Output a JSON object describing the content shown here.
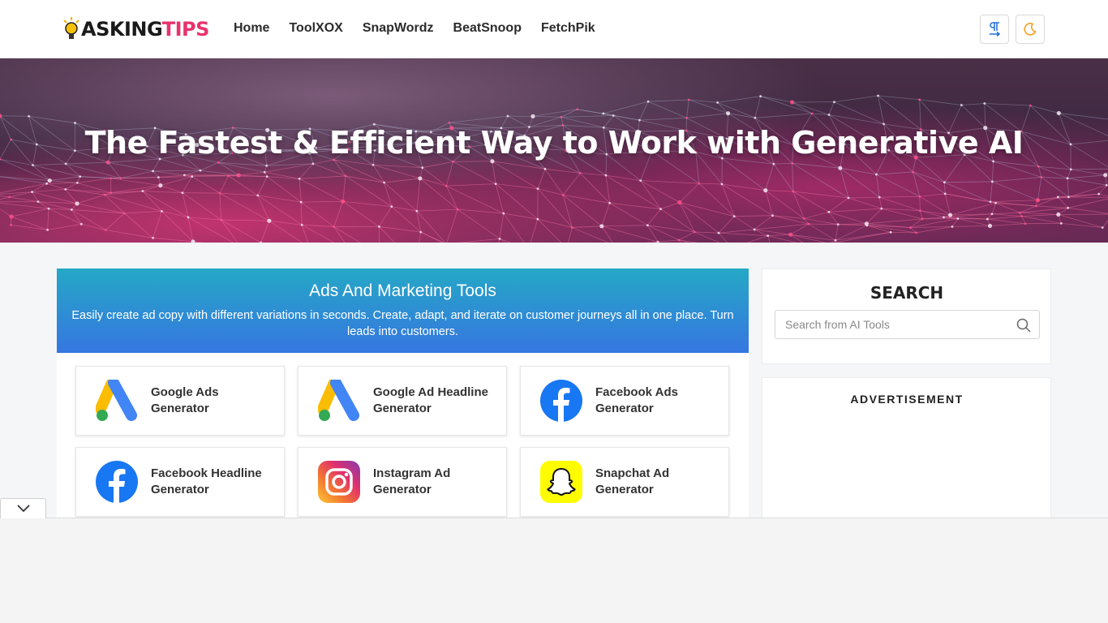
{
  "header": {
    "logo": {
      "part1": "ASKING",
      "part2": "TIPS"
    },
    "nav": [
      "Home",
      "ToolXOX",
      "SnapWordz",
      "BeatSnoop",
      "FetchPik"
    ]
  },
  "hero": {
    "title": "The Fastest & Efficient Way to Work with Generative AI"
  },
  "main": {
    "section_title": "Ads And Marketing Tools",
    "section_desc": "Easily create ad copy with different variations in seconds. Create, adapt, and iterate on customer journeys all in one place. Turn leads into customers.",
    "tools": [
      {
        "line1": "Google Ads",
        "line2": "Generator",
        "icon": "google-ads-icon"
      },
      {
        "line1": "Google Ad Headline",
        "line2": "Generator",
        "icon": "google-ads-icon"
      },
      {
        "line1": "Facebook Ads",
        "line2": "Generator",
        "icon": "facebook-icon"
      },
      {
        "line1": "Facebook Headline",
        "line2": "Generator",
        "icon": "facebook-icon"
      },
      {
        "line1": "Instagram Ad",
        "line2": "Generator",
        "icon": "instagram-icon"
      },
      {
        "line1": "Snapchat Ad",
        "line2": "Generator",
        "icon": "snapchat-icon"
      }
    ]
  },
  "sidebar": {
    "search_title": "SEARCH",
    "search_placeholder": "Search from AI Tools",
    "ad_label": "ADVERTISEMENT"
  },
  "colors": {
    "brand_pink": "#e8336d",
    "header_gradient_top": "#25a8c6",
    "header_gradient_bottom": "#3676e0",
    "theme_icon": "#f0a020"
  }
}
